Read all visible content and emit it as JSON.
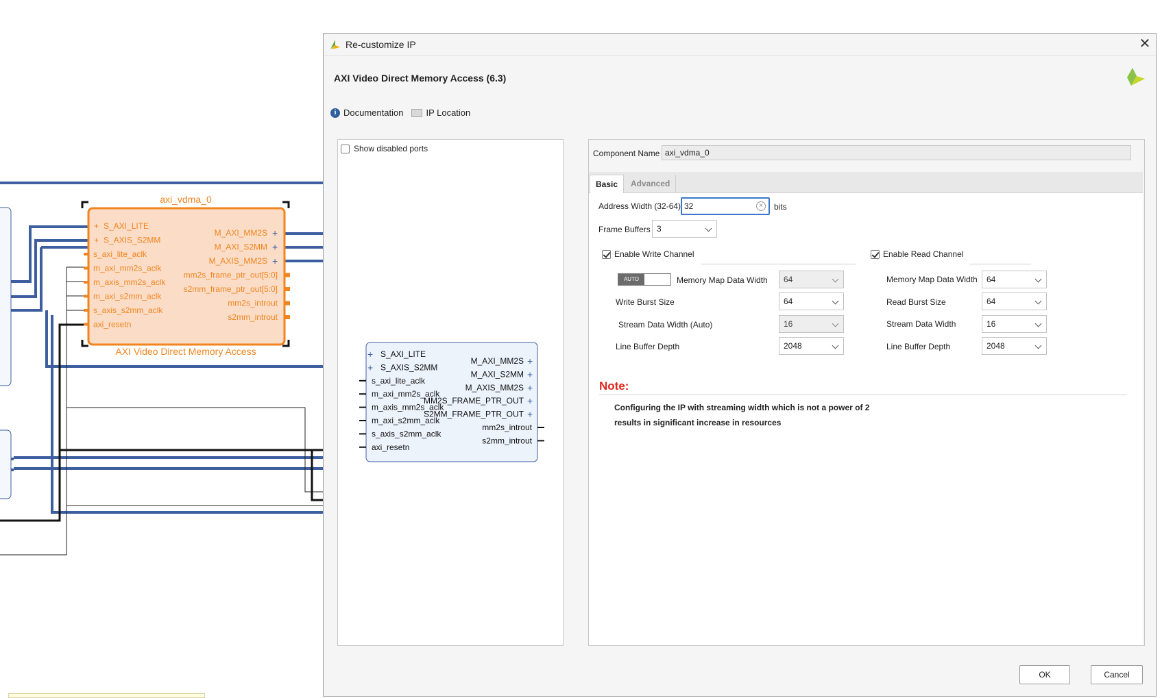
{
  "canvas": {
    "block": {
      "instance_name": "axi_vdma_0",
      "caption": "AXI Video Direct Memory Access",
      "left_ports": [
        "S_AXI_LITE",
        "S_AXIS_S2MM",
        "s_axi_lite_aclk",
        "m_axi_mm2s_aclk",
        "m_axis_mm2s_aclk",
        "m_axi_s2mm_aclk",
        "s_axis_s2mm_aclk",
        "axi_resetn"
      ],
      "right_ports": [
        "M_AXI_MM2S",
        "M_AXI_S2MM",
        "M_AXIS_MM2S",
        "mm2s_frame_ptr_out[5:0]",
        "s2mm_frame_ptr_out[5:0]",
        "mm2s_introut",
        "s2mm_introut"
      ]
    }
  },
  "dialog": {
    "title": "Re-customize IP",
    "ip_title": "AXI Video Direct Memory Access (6.3)",
    "close_glyph": "✕",
    "links": {
      "documentation": "Documentation",
      "ip_location": "IP Location"
    },
    "left_panel": {
      "show_disabled_ports": "Show disabled ports",
      "symbol": {
        "left_ports": [
          "S_AXI_LITE",
          "S_AXIS_S2MM",
          "s_axi_lite_aclk",
          "m_axi_mm2s_aclk",
          "m_axis_mm2s_aclk",
          "m_axi_s2mm_aclk",
          "s_axis_s2mm_aclk",
          "axi_resetn"
        ],
        "right_ports": [
          "M_AXI_MM2S",
          "M_AXI_S2MM",
          "M_AXIS_MM2S",
          "MM2S_FRAME_PTR_OUT",
          "S2MM_FRAME_PTR_OUT",
          "mm2s_introut",
          "s2mm_introut"
        ]
      }
    },
    "component_name": {
      "label": "Component Name",
      "value": "axi_vdma_0"
    },
    "tabs": [
      {
        "label": "Basic",
        "active": true
      },
      {
        "label": "Advanced",
        "active": false
      }
    ],
    "basic": {
      "address_width": {
        "label": "Address Width (32-64)",
        "value": "32",
        "unit": "bits"
      },
      "frame_buffers": {
        "label": "Frame Buffers",
        "value": "3"
      },
      "write": {
        "enable_label": "Enable Write Channel",
        "enabled": true,
        "auto_label": "AUTO",
        "mm_data_width": {
          "label": "Memory Map Data Width",
          "value": "64"
        },
        "burst_size": {
          "label": "Write Burst Size",
          "value": "64"
        },
        "stream_width": {
          "label": "Stream Data Width (Auto)",
          "value": "16"
        },
        "line_buffer": {
          "label": "Line Buffer Depth",
          "value": "2048"
        }
      },
      "read": {
        "enable_label": "Enable Read Channel",
        "enabled": true,
        "mm_data_width": {
          "label": "Memory Map Data Width",
          "value": "64"
        },
        "burst_size": {
          "label": "Read Burst Size",
          "value": "64"
        },
        "stream_width": {
          "label": "Stream Data Width",
          "value": "16"
        },
        "line_buffer": {
          "label": "Line Buffer Depth",
          "value": "2048"
        }
      },
      "note": {
        "title": "Note:",
        "line1": "Configuring the IP with streaming width which is not a power of 2",
        "line2": "results in significant increase in resources"
      }
    },
    "buttons": {
      "ok": "OK",
      "cancel": "Cancel"
    }
  },
  "colors": {
    "accent_orange": "#f0851f",
    "wire_blue": "#3d5f9f",
    "note_red": "#e0261b",
    "focus_blue": "#3a77c9"
  }
}
